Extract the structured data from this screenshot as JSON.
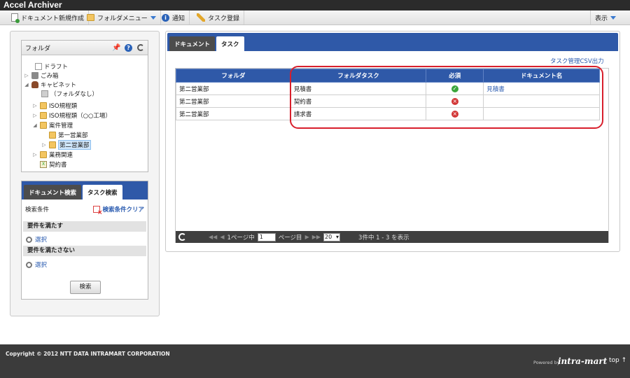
{
  "app": {
    "title": "Accel Archiver"
  },
  "toolbar": {
    "new_doc": "ドキュメント新規作成",
    "folder_menu": "フォルダメニュー",
    "notify": "通知",
    "task_register": "タスク登録",
    "display": "表示"
  },
  "folder_panel": {
    "title": "フォルダ",
    "tree": [
      "ドラフト",
      "ごみ箱",
      "キャビネット",
      "（フォルダなし）",
      "ISO規程類",
      "ISO規程類（○○工場）",
      "案件管理",
      "第一営業部",
      "第二営業部",
      "業務関連",
      "契約書"
    ]
  },
  "search_panel": {
    "tab_doc": "ドキュメント検索",
    "tab_task": "タスク検索",
    "conditions_label": "検索条件",
    "clear_label": "検索条件クリア",
    "must_match": "要件を満たす",
    "must_not_match": "要件を満たさない",
    "select_label": "選択",
    "search_button": "検索"
  },
  "main": {
    "tab_document": "ドキュメント",
    "tab_task": "タスク",
    "csv_link": "タスク管理CSV出力",
    "columns": [
      "フォルダ",
      "フォルダタスク",
      "必須",
      "ドキュメント名"
    ],
    "rows": [
      {
        "folder": "第二営業部",
        "task": "見積書",
        "required": "ok",
        "doc": "見積書"
      },
      {
        "folder": "第二営業部",
        "task": "契約書",
        "required": "ng",
        "doc": ""
      },
      {
        "folder": "第二営業部",
        "task": "請求書",
        "required": "ng",
        "doc": ""
      }
    ],
    "pager": {
      "page_prefix": "1ページ中",
      "page_value": "1",
      "page_suffix": "ページ目",
      "per_page": "20",
      "summary": "3件中 1 - 3 を表示"
    }
  },
  "footer": {
    "copyright": "Copyright © 2012 NTT DATA INTRAMART CORPORATION",
    "powered_by": "Powered by",
    "brand": "intra-mart",
    "top_link": "top ↑"
  },
  "colors": {
    "accent": "#2f59a8",
    "highlight": "#d81f2c",
    "dark": "#3b3b3b"
  }
}
